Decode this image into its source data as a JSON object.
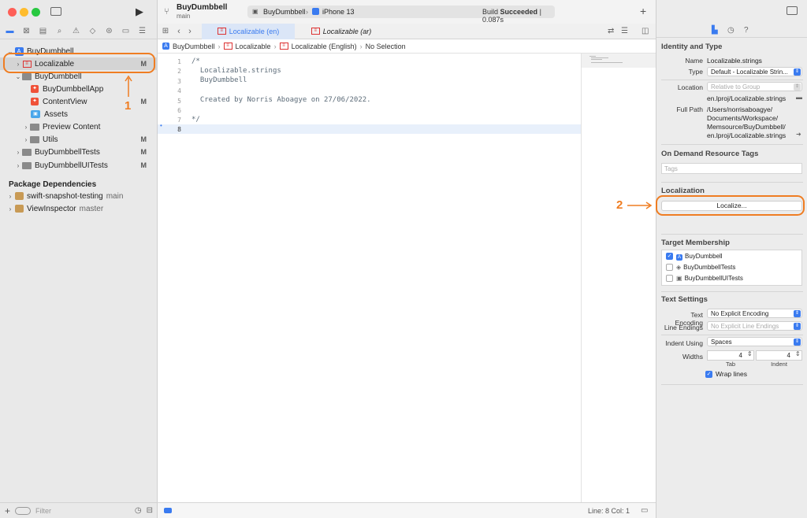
{
  "window": {
    "scheme": "BuyDumbbell",
    "branch": "main",
    "target_scheme": "BuyDumbbell",
    "device": "iPhone 13",
    "build_status_prefix": "Build",
    "build_status_word": "Succeeded",
    "build_time": "0.087s"
  },
  "navigator": {
    "project": "BuyDumbbell",
    "items": [
      {
        "label": "Localizable",
        "badge": "M"
      },
      {
        "label": "BuyDumbbell",
        "badge": ""
      },
      {
        "label": "BuyDumbbellApp",
        "badge": ""
      },
      {
        "label": "ContentView",
        "badge": "M"
      },
      {
        "label": "Assets",
        "badge": ""
      },
      {
        "label": "Preview Content",
        "badge": ""
      },
      {
        "label": "Utils",
        "badge": "M"
      },
      {
        "label": "BuyDumbbellTests",
        "badge": "M"
      },
      {
        "label": "BuyDumbbellUITests",
        "badge": "M"
      }
    ],
    "package_header": "Package Dependencies",
    "packages": [
      {
        "name": "swift-snapshot-testing",
        "branch": "main"
      },
      {
        "name": "ViewInspector",
        "branch": "master"
      }
    ],
    "filter_placeholder": "Filter"
  },
  "editor": {
    "tabs": [
      "Localizable (en)",
      "Localizable (ar)"
    ],
    "breadcrumb": [
      "BuyDumbbell",
      "Localizable",
      "Localizable (English)",
      "No Selection"
    ],
    "lines": [
      {
        "n": "1",
        "text": "/*"
      },
      {
        "n": "2",
        "text": "  Localizable.strings"
      },
      {
        "n": "3",
        "text": "  BuyDumbbell"
      },
      {
        "n": "4",
        "text": ""
      },
      {
        "n": "5",
        "text": "  Created by Norris Aboagye on 27/06/2022."
      },
      {
        "n": "6",
        "text": ""
      },
      {
        "n": "7",
        "text": "*/"
      },
      {
        "n": "8",
        "text": ""
      }
    ],
    "status": "Line: 8  Col: 1"
  },
  "inspector": {
    "identity_header": "Identity and Type",
    "name_label": "Name",
    "name_value": "Localizable.strings",
    "type_label": "Type",
    "type_value": "Default - Localizable Strin...",
    "location_label": "Location",
    "location_value": "Relative to Group",
    "location_file": "en.lproj/Localizable.strings",
    "fullpath_label": "Full Path",
    "fullpath_lines": [
      "/Users/norrisaboagye/",
      "Documents/Workspace/",
      "Memsource/BuyDumbbell/",
      "en.lproj/Localizable.strings"
    ],
    "ondemand_header": "On Demand Resource Tags",
    "tags_placeholder": "Tags",
    "localization_header": "Localization",
    "localize_button": "Localize...",
    "membership_header": "Target Membership",
    "targets": [
      {
        "name": "BuyDumbbell",
        "checked": true
      },
      {
        "name": "BuyDumbbellTests",
        "checked": false
      },
      {
        "name": "BuyDumbbellUITests",
        "checked": false
      }
    ],
    "text_settings_header": "Text Settings",
    "encoding_label": "Text Encoding",
    "encoding_value": "No Explicit Encoding",
    "endings_label": "Line Endings",
    "endings_value": "No Explicit Line Endings",
    "indent_label": "Indent Using",
    "indent_value": "Spaces",
    "widths_label": "Widths",
    "tab_value": "4",
    "indent_width_value": "4",
    "tab_caption": "Tab",
    "indent_caption": "Indent",
    "wrap_label": "Wrap lines"
  },
  "annotations": {
    "one": "1",
    "two": "2"
  },
  "colors": {
    "accent": "#3a7bf0",
    "annotation": "#ef7d22",
    "swift": "#f05138"
  }
}
